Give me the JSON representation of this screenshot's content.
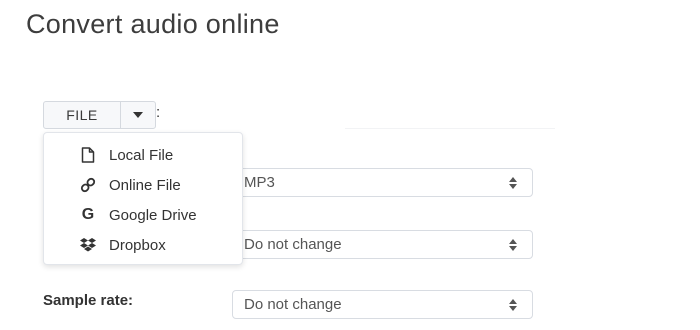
{
  "page": {
    "title": "Convert audio online"
  },
  "file_input": {
    "button_label": "FILE",
    "colon": ":",
    "menu": [
      {
        "label": "Local File",
        "icon": "file-icon"
      },
      {
        "label": "Online File",
        "icon": "link-icon"
      },
      {
        "label": "Google Drive",
        "icon": "google-icon"
      },
      {
        "label": "Dropbox",
        "icon": "dropbox-icon"
      }
    ]
  },
  "options": {
    "format_value": "MP3",
    "second_value": "Do not change",
    "sample_rate_label": "Sample rate:",
    "sample_rate_value": "Do not change"
  },
  "colors": {
    "text": "#333333",
    "border": "#d8dce2",
    "button_bg": "#f7f8fa"
  }
}
